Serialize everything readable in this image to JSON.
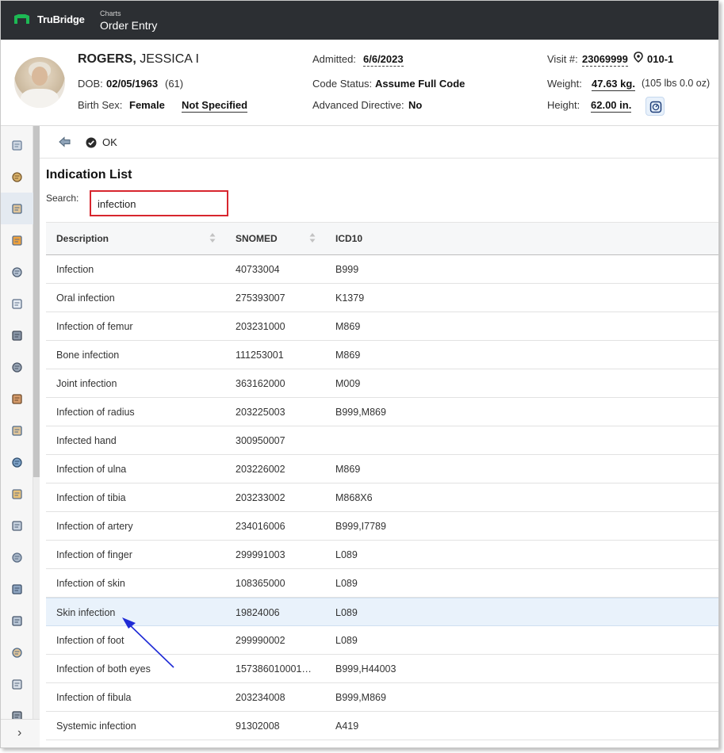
{
  "topbar": {
    "brand": "TruBridge",
    "section": "Charts",
    "page": "Order Entry"
  },
  "patient": {
    "last_name": "ROGERS,",
    "first_name": " JESSICA I",
    "dob_label": "DOB:",
    "dob": "02/05/1963",
    "age": "(61)",
    "sex_label": "Birth Sex:",
    "sex": "Female",
    "gender": "Not Specified",
    "admitted_label": "Admitted:",
    "admitted": "6/6/2023",
    "code_status_label": "Code Status:",
    "code_status": "Assume Full Code",
    "adv_dir_label": "Advanced Directive:",
    "adv_dir": "No",
    "visit_label": "Visit #:",
    "visit": "23069999",
    "location": "010-1",
    "weight_label": "Weight:",
    "weight": "47.63 kg.",
    "weight_alt": "(105 lbs 0.0 oz)",
    "height_label": "Height:",
    "height": "62.00 in."
  },
  "toolbar": {
    "ok_label": "OK"
  },
  "indication": {
    "title": "Indication List",
    "search_label": "Search:",
    "search_value": "infection"
  },
  "table": {
    "columns": [
      "Description",
      "SNOMED",
      "ICD10"
    ],
    "rows": [
      [
        "Infection",
        "40733004",
        "B999"
      ],
      [
        "Oral infection",
        "275393007",
        "K1379"
      ],
      [
        "Infection of femur",
        "203231000",
        "M869"
      ],
      [
        "Bone infection",
        "111253001",
        "M869"
      ],
      [
        "Joint infection",
        "363162000",
        "M009"
      ],
      [
        "Infection of radius",
        "203225003",
        "B999,M869"
      ],
      [
        "Infected hand",
        "300950007",
        ""
      ],
      [
        "Infection of ulna",
        "203226002",
        "M869"
      ],
      [
        "Infection of tibia",
        "203233002",
        "M868X6"
      ],
      [
        "Infection of artery",
        "234016006",
        "B999,I7789"
      ],
      [
        "Infection of finger",
        "299991003",
        "L089"
      ],
      [
        "Infection of skin",
        "108365000",
        "L089"
      ],
      [
        "Skin infection",
        "19824006",
        "L089"
      ],
      [
        "Infection of foot",
        "299990002",
        "L089"
      ],
      [
        "Infection of both eyes",
        "157386010001…",
        "B999,H44003"
      ],
      [
        "Infection of fibula",
        "203234008",
        "B999,M869"
      ],
      [
        "Systemic infection",
        "91302008",
        "A419"
      ]
    ],
    "selected_index": 12
  },
  "sidebar": {
    "items": [
      "chart-summary-icon",
      "clock-icon",
      "orders-icon",
      "medications-icon",
      "documents-icon",
      "notes-icon",
      "device-icon",
      "database-icon",
      "person-icon",
      "orders-alt-icon",
      "globe-icon",
      "calendar-icon",
      "lab-flask-icon",
      "syringe-icon",
      "settings-icon",
      "checklist-icon",
      "orders-doc-icon",
      "report-icon",
      "print-icon"
    ],
    "active_index": 2,
    "expand_glyph": "›"
  },
  "colors": {
    "topbar": "#2c2f33",
    "brand_green": "#1db954",
    "search_border": "#d8262e",
    "selected_row": "#e9f2fb",
    "annotation_arrow": "#1f2bd6"
  }
}
